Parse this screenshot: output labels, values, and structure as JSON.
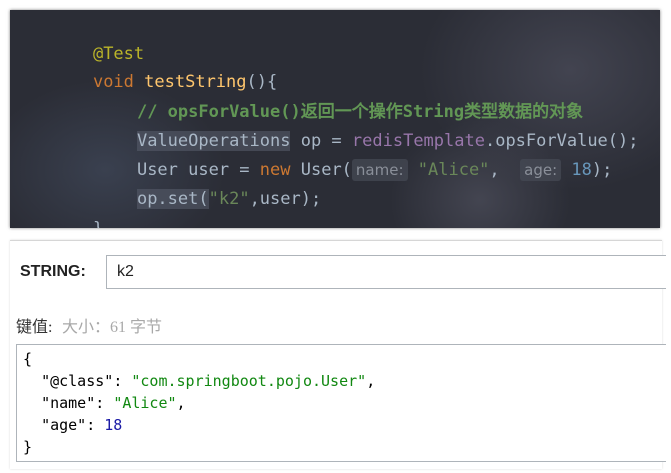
{
  "editor": {
    "annotation": "@Test",
    "method_return": "void",
    "method_name": "testString",
    "method_paren": "(){",
    "comment": "// opsForValue()返回一个操作String类型数据的对象",
    "line_ops": {
      "type": "ValueOperations",
      "var": " op = ",
      "field": "redisTemplate",
      "call": ".opsForValue();"
    },
    "line_user": {
      "type": "User user = ",
      "kw_new": "new",
      "ctor": " User(",
      "hint_name": "name:",
      "arg_name": "\"Alice\"",
      "comma": ",",
      "hint_age": "age:",
      "arg_age": "18",
      "end": ");"
    },
    "line_set": {
      "call": "op.set(",
      "key": "\"k2\"",
      "rest": ",user);"
    },
    "close_brace": "}"
  },
  "viewer": {
    "type_label": "STRING:",
    "key_value": "k2",
    "value_label": "键值:",
    "size_text": "大小：61 字节",
    "json": {
      "open": "{",
      "class_key": "\"@class\"",
      "class_value": "\"com.springboot.pojo.User\"",
      "name_key": "\"name\"",
      "name_value": "\"Alice\"",
      "age_key": "\"age\"",
      "age_value": "18",
      "close": "}"
    }
  },
  "colors": {
    "editor_bg": "#2b2d36",
    "keyword": "#cc7832",
    "method": "#ffc66d",
    "comment": "#629755",
    "field": "#9876aa",
    "string": "#6a8759",
    "number": "#6897bb",
    "json_string": "#118811",
    "json_number": "#1a1aa6"
  }
}
